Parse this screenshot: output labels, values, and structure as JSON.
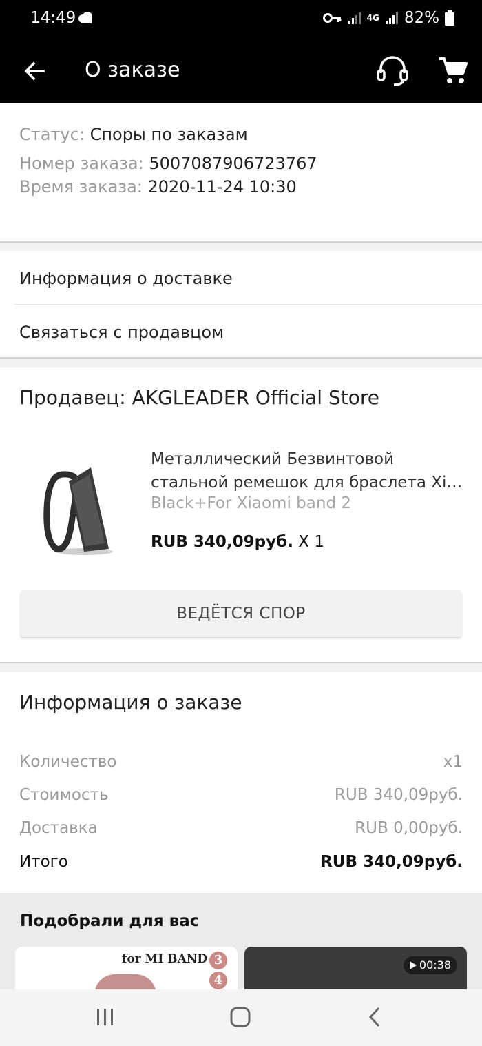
{
  "status_bar": {
    "time": "14:49",
    "network": "4G",
    "battery": "82%"
  },
  "app_bar": {
    "title": "О заказе",
    "icons": [
      "back-arrow-icon",
      "headset-icon",
      "cart-icon"
    ]
  },
  "order": {
    "status_label": "Статус:",
    "status_value": "Споры по заказам",
    "number_label": "Номер заказа:",
    "number_value": "5007087906723767",
    "time_label": "Время заказа:",
    "time_value": "2020-11-24 10:30"
  },
  "links": {
    "delivery": "Информация о доставке",
    "contact_seller": "Связаться с продавцом"
  },
  "seller": {
    "name": "Продавец: AKGLEADER Official Store",
    "product": {
      "title_line1": "Металлический Безвинтовой",
      "title_line2": "стальной ремешок для браслета Xiaomi Mi Band",
      "variant": "Black+For Xiaomi band 2",
      "price": "RUB 340,09руб.",
      "quantity": "X 1"
    },
    "dispute_button": "ВЕДЁТСЯ СПОР"
  },
  "summary": {
    "title": "Информация о заказе",
    "rows": [
      {
        "label": "Количество",
        "value": "x1"
      },
      {
        "label": "Стоимость",
        "value": "RUB 340,09руб."
      },
      {
        "label": "Доставка",
        "value": "RUB 0,00руб."
      }
    ],
    "total_label": "Итого",
    "total_value": "RUB 340,09руб."
  },
  "recommendations": {
    "title": "Подобрали для вас",
    "card1_brand": "for MI BAND",
    "card1_num3": "3",
    "card1_num4": "4",
    "card2_duration": "00:38"
  },
  "colors": {
    "bar": "#000000",
    "section_gap": "#f2f2f2",
    "muted_text": "#9a9a9a"
  }
}
